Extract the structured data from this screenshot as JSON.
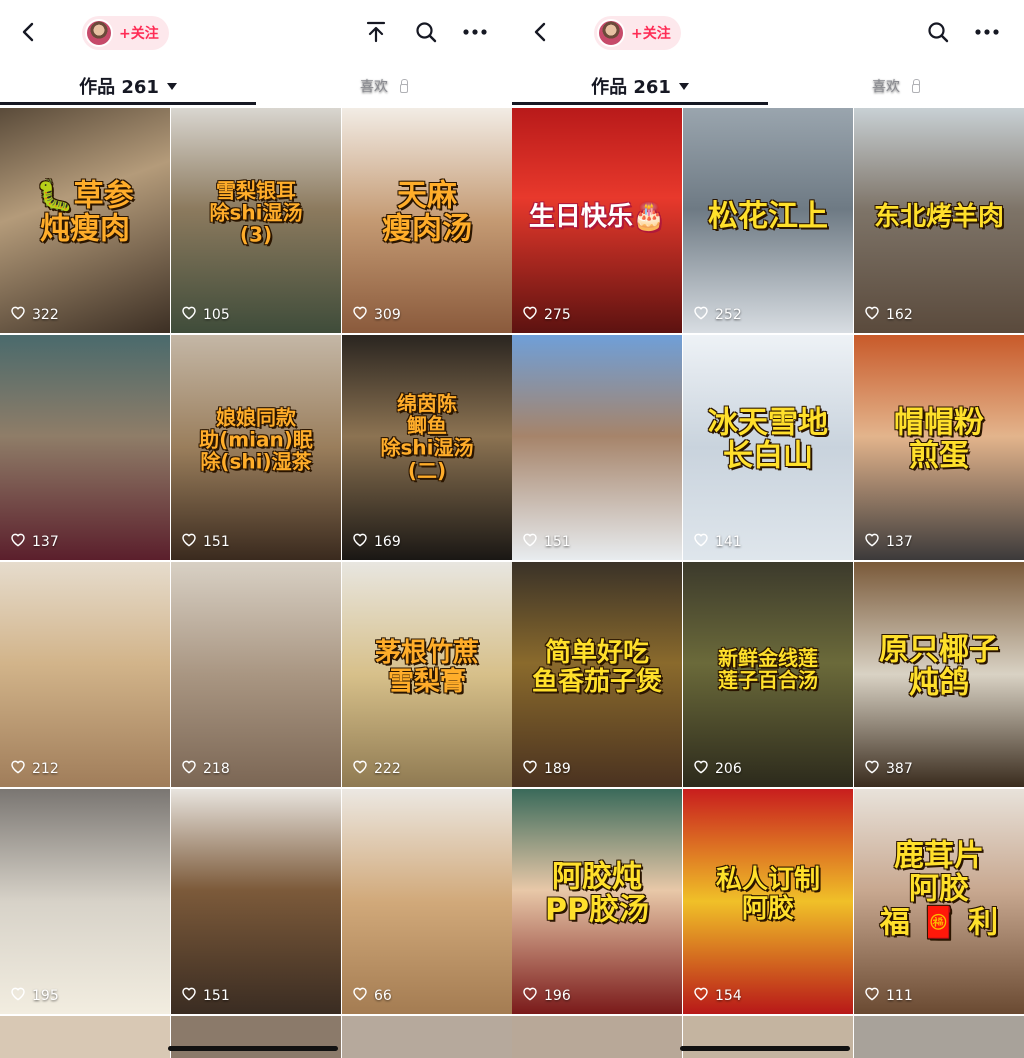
{
  "left_panel": {
    "follow_label": "+关注",
    "tabs": {
      "works": "作品 261",
      "likes": "喜欢"
    },
    "videos": [
      {
        "caption": "🐛草参\n炖瘦肉",
        "likes": "322",
        "style": "big orange",
        "bg": "linear-gradient(160deg,#5a4b3a 0%,#b49b7a 40%,#3c2f24 100%)"
      },
      {
        "caption": "雪梨银耳\n除shi湿汤\n(3)",
        "likes": "105",
        "style": "sm orange",
        "bg": "linear-gradient(180deg,#d9d6d0 0%,#8c7a5e 45%,#3f4c3a 100%)"
      },
      {
        "caption": "天麻\n瘦肉汤",
        "likes": "309",
        "style": "big orange",
        "bg": "linear-gradient(180deg,#f2ece5 0%,#c49a73 50%,#8a5a3c 100%)"
      },
      {
        "caption": "",
        "likes": "137",
        "style": "sm orange",
        "bg": "linear-gradient(180deg,#4a6a6c 0%,#8f7d68 45%,#5b1f2c 100%)"
      },
      {
        "caption": "娘娘同款\n助(mian)眠\n除(shi)湿茶",
        "likes": "151",
        "style": "sm orange",
        "bg": "linear-gradient(180deg,#c4b7a6 0%,#9a7e5c 50%,#3a2a1e 100%)"
      },
      {
        "caption": "绵茵陈\n鲫鱼\n除shi湿汤\n(二)",
        "likes": "169",
        "style": "sm orange",
        "bg": "linear-gradient(180deg,#2a2520 0%,#8c7352 45%,#1a1714 100%)"
      },
      {
        "caption": "",
        "likes": "212",
        "style": "sm orange",
        "bg": "linear-gradient(180deg,#e6dccd 0%,#d2b48a 45%,#a07d5a 100%)"
      },
      {
        "caption": "",
        "likes": "218",
        "style": "sm orange",
        "bg": "linear-gradient(180deg,#d8d0c4 0%,#a99682 50%,#7b6654 100%)"
      },
      {
        "caption": "茅根竹蔗\n雪梨膏",
        "likes": "222",
        "style": "mid orange",
        "bg": "linear-gradient(180deg,#e8e6e0 0%,#d7c08a 50%,#8f7a52 100%)"
      },
      {
        "caption": "",
        "likes": "195",
        "style": "sm orange",
        "bg": "linear-gradient(180deg,#7a7672 0%,#d7d2c8 50%,#f2ede0 100%)"
      },
      {
        "caption": "",
        "likes": "151",
        "style": "sm orange",
        "bg": "linear-gradient(180deg,#e8e4de 0%,#7c5a3a 45%,#3a2c22 100%)"
      },
      {
        "caption": "",
        "likes": "66",
        "style": "sm orange",
        "bg": "linear-gradient(180deg,#ece8e2 0%,#d1a97a 50%,#a47c52 100%)"
      }
    ],
    "bottom_row_bg": [
      "#d8c8b4",
      "#8b7a6a",
      "#b6a99c"
    ]
  },
  "right_panel": {
    "follow_label": "+关注",
    "tabs": {
      "works": "作品 261",
      "likes": "喜欢"
    },
    "videos": [
      {
        "caption": "生日快乐🎂",
        "likes": "275",
        "style": "mid white",
        "bg": "linear-gradient(180deg,#b81a1a 0%,#e8392c 40%,#5c1210 100%)"
      },
      {
        "caption": "松花江上",
        "likes": "252",
        "style": "big yellow",
        "bg": "linear-gradient(180deg,#9aa5ae 0%,#6e7a84 45%,#d8dde2 100%)"
      },
      {
        "caption": "东北烤羊肉",
        "likes": "162",
        "style": "mid yellow",
        "bg": "linear-gradient(180deg,#c8d0d4 0%,#7e7468 45%,#5a4a3c 100%)"
      },
      {
        "caption": "",
        "likes": "151",
        "style": "sm yellow",
        "bg": "linear-gradient(180deg,#6f9fd8 0%,#a6846a 45%,#e8ecef 100%)"
      },
      {
        "caption": "冰天雪地\n长白山",
        "likes": "141",
        "style": "big yellow",
        "bg": "linear-gradient(180deg,#eef2f6 0%,#c9d3dd 50%,#dfe6ec 100%)"
      },
      {
        "caption": "帽帽粉\n煎蛋",
        "likes": "137",
        "style": "big yellow",
        "bg": "linear-gradient(180deg,#c85a2a 0%,#e3b48c 45%,#3c3a3a 100%)"
      },
      {
        "caption": "简单好吃\n鱼香茄子煲",
        "likes": "189",
        "style": "mid yellow",
        "bg": "linear-gradient(180deg,#3a3228 0%,#8a6a2c 45%,#4a3220 100%)"
      },
      {
        "caption": "新鲜金线莲\n莲子百合汤",
        "likes": "206",
        "style": "sm yellow",
        "bg": "linear-gradient(180deg,#3c3a2c 0%,#6b6a3a 45%,#2c2a1c 100%)"
      },
      {
        "caption": "原只椰子\n炖鸽",
        "likes": "387",
        "style": "big yellow",
        "bg": "linear-gradient(180deg,#7a5a3a 0%,#d9d2c4 50%,#3a2c1e 100%)"
      },
      {
        "caption": "阿胶炖\nPP胶汤",
        "likes": "196",
        "style": "big yellow",
        "bg": "linear-gradient(180deg,#3a6a5a 0%,#e8c8a8 45%,#7a1a1a 100%)"
      },
      {
        "caption": "私人订制\n阿胶",
        "likes": "154",
        "style": "mid yellow",
        "bg": "linear-gradient(180deg,#c81e1e 0%,#f0c028 50%,#b81818 100%)"
      },
      {
        "caption": "鹿茸片\n阿胶\n福 🧧 利",
        "likes": "111",
        "style": "big yellow",
        "bg": "linear-gradient(180deg,#e8e2da 0%,#c8a890 45%,#6a4a32 100%)"
      }
    ],
    "bottom_row_bg": [
      "#b8a898",
      "#c4b4a0",
      "#a8a29a"
    ]
  }
}
